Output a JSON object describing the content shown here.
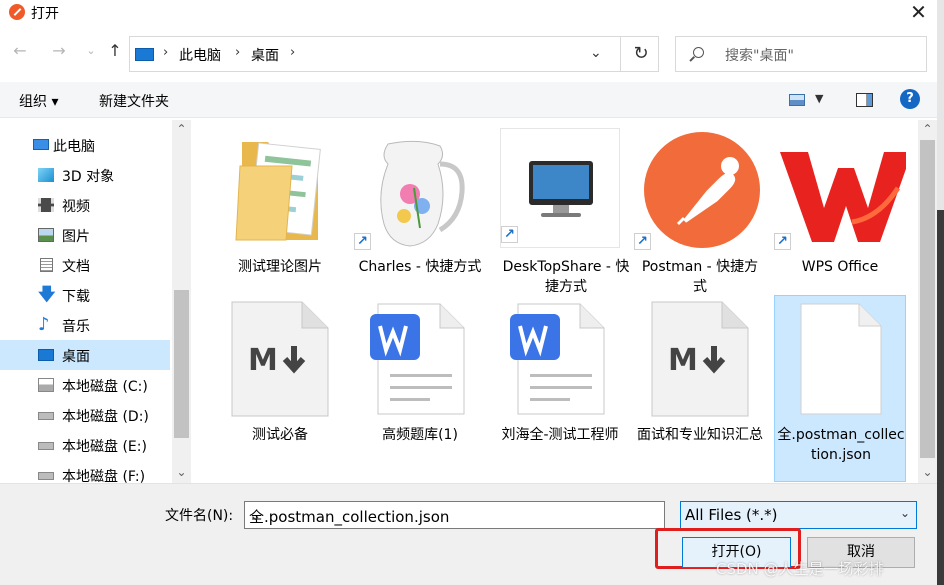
{
  "window": {
    "title": "打开",
    "close_glyph": "✕"
  },
  "address": {
    "crumbs": [
      "此电脑",
      "桌面"
    ],
    "dropdown_glyph": "⌄",
    "refresh_glyph": "↻"
  },
  "search": {
    "placeholder": "搜索\"桌面\""
  },
  "toolbar": {
    "organize": "组织 ▾",
    "new_folder": "新建文件夹",
    "help": "?"
  },
  "nav": {
    "items": [
      {
        "label": "此电脑",
        "icon": "computer-icon"
      },
      {
        "label": "3D 对象",
        "icon": "cube-icon"
      },
      {
        "label": "视频",
        "icon": "video-icon"
      },
      {
        "label": "图片",
        "icon": "picture-icon"
      },
      {
        "label": "文档",
        "icon": "document-icon"
      },
      {
        "label": "下载",
        "icon": "download-icon"
      },
      {
        "label": "音乐",
        "icon": "music-icon"
      },
      {
        "label": "桌面",
        "icon": "desktop-icon",
        "selected": true
      },
      {
        "label": "本地磁盘 (C:)",
        "icon": "windows-drive-icon"
      },
      {
        "label": "本地磁盘 (D:)",
        "icon": "drive-icon"
      },
      {
        "label": "本地磁盘 (E:)",
        "icon": "drive-icon"
      },
      {
        "label": "本地磁盘 (F:)",
        "icon": "drive-icon"
      }
    ]
  },
  "files": [
    {
      "name": "测试理论图片",
      "icon": "folder-icon"
    },
    {
      "name": "Charles - 快捷方式",
      "icon": "charles-pitcher-icon",
      "shortcut": true
    },
    {
      "name": "DeskTopShare - 快捷方式",
      "icon": "monitor-icon",
      "shortcut": true
    },
    {
      "name": "Postman - 快捷方式",
      "icon": "postman-icon",
      "shortcut": true
    },
    {
      "name": "WPS Office",
      "icon": "wps-icon",
      "shortcut": true
    },
    {
      "name": "测试必备",
      "icon": "markdown-file-icon"
    },
    {
      "name": "高频题库(1)",
      "icon": "word-file-icon"
    },
    {
      "name": "刘海全-测试工程师",
      "icon": "word-file-icon"
    },
    {
      "name": "面试和专业知识汇总",
      "icon": "markdown-file-icon"
    },
    {
      "name": "全.postman_collection.json",
      "icon": "blank-file-icon",
      "selected": true
    }
  ],
  "bottom": {
    "filename_label": "文件名(N):",
    "filename_value": "全.postman_collection.json",
    "filter_value": "All Files (*.*)",
    "open_button": "打开(O)",
    "cancel_button": "取消",
    "watermark": "CSDN @人生是一场彩排"
  },
  "colors": {
    "selection": "#cce8ff",
    "accent": "#0078d7",
    "highlight_outline": "#e01e1e"
  }
}
